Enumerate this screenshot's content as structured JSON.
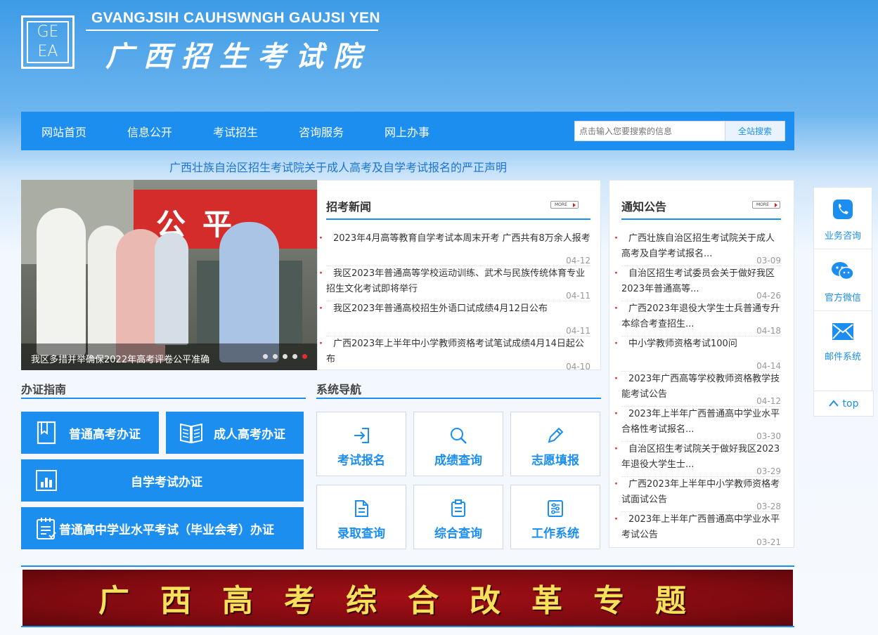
{
  "header": {
    "logo_letters": [
      "GE",
      "EA"
    ],
    "site_en": "GVANGJSIH CAUHSWNGH GAUJSI YEN",
    "site_cn": "广西招生考试院"
  },
  "nav": {
    "items": [
      "网站首页",
      "信息公开",
      "考试招生",
      "咨询服务",
      "网上办事"
    ],
    "search_placeholder": "点击输入您要搜索的信息",
    "search_button": "全站搜索"
  },
  "announcement": "广西壮族自治区招生考试院关于成人高考及自学考试报名的严正声明",
  "slider": {
    "banner_text": "公平 和",
    "caption": "我区多措并举确保2022年高考评卷公平准确"
  },
  "news": {
    "title": "招考新闻",
    "more": "MORE",
    "items": [
      {
        "text": "2023年4月高等教育自学考试本周末开考 广西共有8万余人报考",
        "date": "04-12"
      },
      {
        "text": "我区2023年普通高等学校运动训练、武术与民族传统体育专业招生文化考试即将举行",
        "date": "04-11"
      },
      {
        "text": "我区2023年普通高校招生外语口试成绩4月12日公布",
        "date": "04-11"
      },
      {
        "text": "广西2023年上半年中小学教师资格考试笔试成绩4月14日起公布",
        "date": "04-10"
      }
    ]
  },
  "notices": {
    "title": "通知公告",
    "more": "MORE",
    "items": [
      {
        "text": "广西壮族自治区招生考试院关于成人高考及自学考试报名...",
        "date": "03-09"
      },
      {
        "text": "自治区招生考试委员会关于做好我区2023年普通高等...",
        "date": "04-26"
      },
      {
        "text": "广西2023年退役大学生士兵普通专升本综合考查招生...",
        "date": "04-18"
      },
      {
        "text": "中小学教师资格考试100问",
        "date": "04-14"
      },
      {
        "text": "2023年广西高等学校教师资格教学技能考试公告",
        "date": "04-12"
      },
      {
        "text": "2023年上半年广西普通高中学业水平合格性考试报名...",
        "date": "03-30"
      },
      {
        "text": "自治区招生考试院关于做好我区2023年退役大学生士...",
        "date": "03-29"
      },
      {
        "text": "广西2023年上半年中小学教师资格考试面试公告",
        "date": "03-28"
      },
      {
        "text": "2023年上半年广西普通高中学业水平考试公告",
        "date": "03-21"
      }
    ]
  },
  "guide": {
    "title": "办证指南",
    "buttons": [
      "普通高考办证",
      "成人高考办证",
      "自学考试办证",
      "普通高中学业水平考试（毕业会考）办证"
    ]
  },
  "system": {
    "title": "系统导航",
    "tiles": [
      "考试报名",
      "成绩查询",
      "志愿填报",
      "录取查询",
      "综合查询",
      "工作系统"
    ]
  },
  "sidebar": {
    "items": [
      "业务咨询",
      "官方微信",
      "邮件系统"
    ],
    "top": "top"
  },
  "reform_banner": "广西高考综合改革专题",
  "colors": {
    "primary": "#1b8ef0",
    "accent_red": "#e02020",
    "banner_red": "#8b0c12",
    "banner_text": "#f7e15a"
  }
}
